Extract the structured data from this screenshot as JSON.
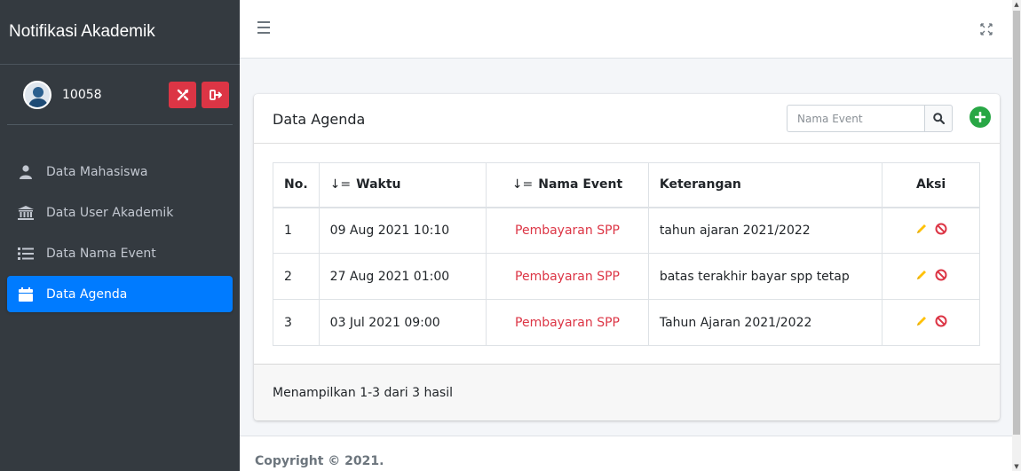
{
  "app": {
    "title": "Notifikasi Akademik"
  },
  "user": {
    "id": "10058"
  },
  "sidebar": {
    "items": [
      {
        "label": "Data Mahasiswa",
        "icon": "user-icon"
      },
      {
        "label": "Data User Akademik",
        "icon": "university-icon"
      },
      {
        "label": "Data Nama Event",
        "icon": "list-icon"
      },
      {
        "label": "Data Agenda",
        "icon": "calendar-icon",
        "active": true
      }
    ]
  },
  "card": {
    "title": "Data Agenda",
    "search_placeholder": "Nama Event",
    "columns": [
      "No.",
      "Waktu",
      "Nama Event",
      "Keterangan",
      "Aksi"
    ],
    "rows": [
      {
        "no": "1",
        "waktu": "09 Aug 2021 10:10",
        "event": "Pembayaran SPP",
        "keterangan": "tahun ajaran 2021/2022"
      },
      {
        "no": "2",
        "waktu": "27 Aug 2021 01:00",
        "event": "Pembayaran SPP",
        "keterangan": "batas terakhir bayar spp tetap"
      },
      {
        "no": "3",
        "waktu": "03 Jul 2021 09:00",
        "event": "Pembayaran SPP",
        "keterangan": "Tahun Ajaran 2021/2022"
      }
    ],
    "footer": "Menampilkan 1-3 dari 3 hasil"
  },
  "copyright": "Copyright © 2021.",
  "colors": {
    "sidebar": "#343a40",
    "active": "#007bff",
    "danger": "#dc3545",
    "success": "#28a745",
    "warning": "#ffc107"
  }
}
